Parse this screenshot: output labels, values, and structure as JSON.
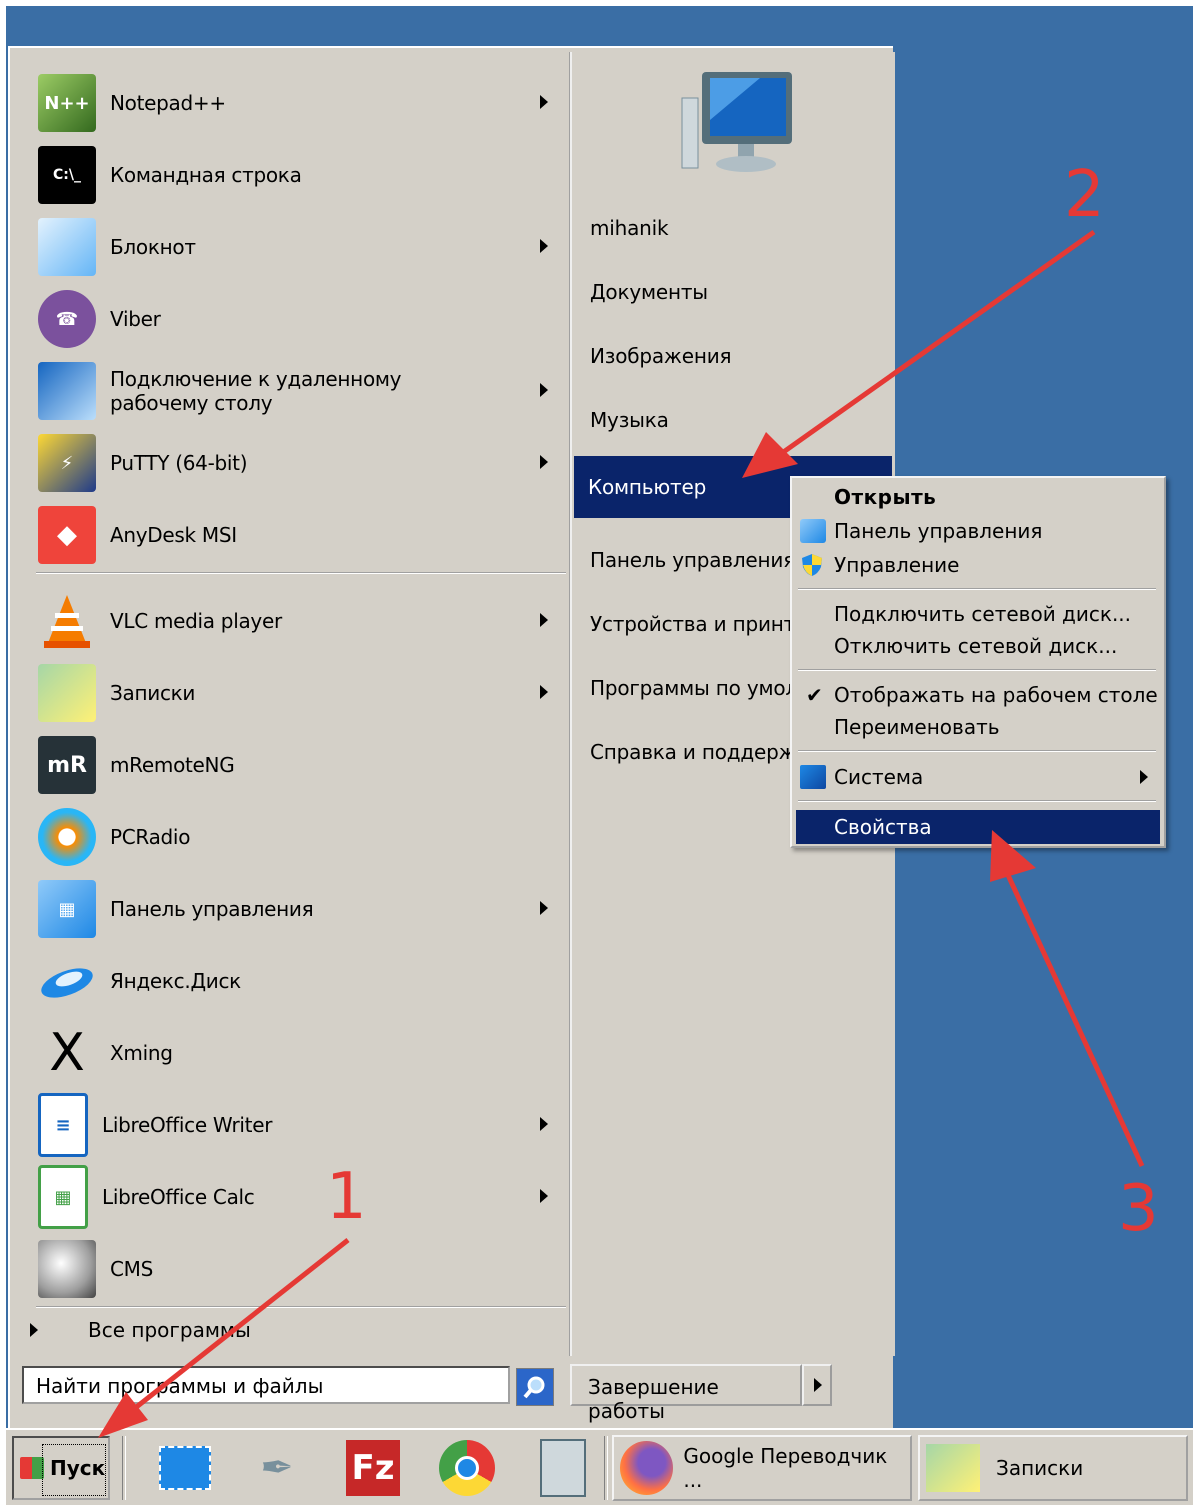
{
  "start_menu": {
    "programs": [
      {
        "label": "Notepad++",
        "icon": "notepad-plus-plus-icon",
        "has_submenu": true
      },
      {
        "label": "Командная строка",
        "icon": "command-prompt-icon",
        "has_submenu": false
      },
      {
        "label": "Блокнот",
        "icon": "notepad-icon",
        "has_submenu": true
      },
      {
        "label": "Viber",
        "icon": "viber-icon",
        "has_submenu": false
      },
      {
        "label": "Подключение к удаленному рабочему столу",
        "icon": "remote-desktop-icon",
        "has_submenu": true
      },
      {
        "label": "PuTTY (64-bit)",
        "icon": "putty-icon",
        "has_submenu": true
      },
      {
        "label": "AnyDesk MSI",
        "icon": "anydesk-icon",
        "has_submenu": false
      },
      {
        "label": "VLC media player",
        "icon": "vlc-icon",
        "has_submenu": true
      },
      {
        "label": "Записки",
        "icon": "sticky-notes-icon",
        "has_submenu": true
      },
      {
        "label": "mRemoteNG",
        "icon": "mremoteng-icon",
        "has_submenu": false
      },
      {
        "label": "PCRadio",
        "icon": "pcradio-icon",
        "has_submenu": false
      },
      {
        "label": "Панель управления",
        "icon": "control-panel-icon",
        "has_submenu": true
      },
      {
        "label": "Яндекс.Диск",
        "icon": "yandex-disk-icon",
        "has_submenu": false
      },
      {
        "label": "Xming",
        "icon": "xming-icon",
        "has_submenu": false
      },
      {
        "label": "LibreOffice Writer",
        "icon": "libreoffice-writer-icon",
        "has_submenu": true
      },
      {
        "label": "LibreOffice Calc",
        "icon": "libreoffice-calc-icon",
        "has_submenu": true
      },
      {
        "label": "CMS",
        "icon": "cms-icon",
        "has_submenu": false
      }
    ],
    "all_programs": "Все программы",
    "search_placeholder": "Найти программы и файлы",
    "right_items": [
      "mihanik",
      "Документы",
      "Изображения",
      "Музыка",
      "Компьютер",
      "Панель управления",
      "Устройства и принтеры",
      "Программы по умолчанию",
      "Справка и поддержка"
    ],
    "selected_right_item": "Компьютер",
    "shutdown_label": "Завершение работы"
  },
  "context_menu": {
    "open": "Открыть",
    "control_panel": "Панель управления",
    "manage": "Управление",
    "map_drive": "Подключить сетевой диск...",
    "disconnect_drive": "Отключить сетевой диск...",
    "show_on_desktop": "Отображать на рабочем столе",
    "rename": "Переименовать",
    "system": "Система",
    "properties": "Свойства"
  },
  "taskbar": {
    "start_label": "Пуск",
    "tasks": [
      {
        "label": "Google Переводчик ...",
        "icon": "firefox-icon"
      },
      {
        "label": "Записки",
        "icon": "sticky-notes-icon"
      }
    ],
    "quick_launch": [
      "snipping-tool-icon",
      "feather-pen-icon",
      "filezilla-icon",
      "chrome-icon",
      "calculator-icon"
    ]
  },
  "annotations": [
    "1",
    "2",
    "3"
  ],
  "colors": {
    "desktop": "#3a6ea5",
    "menu": "#d4d0c8",
    "selection": "#0a246a",
    "annotation": "#e53935"
  }
}
